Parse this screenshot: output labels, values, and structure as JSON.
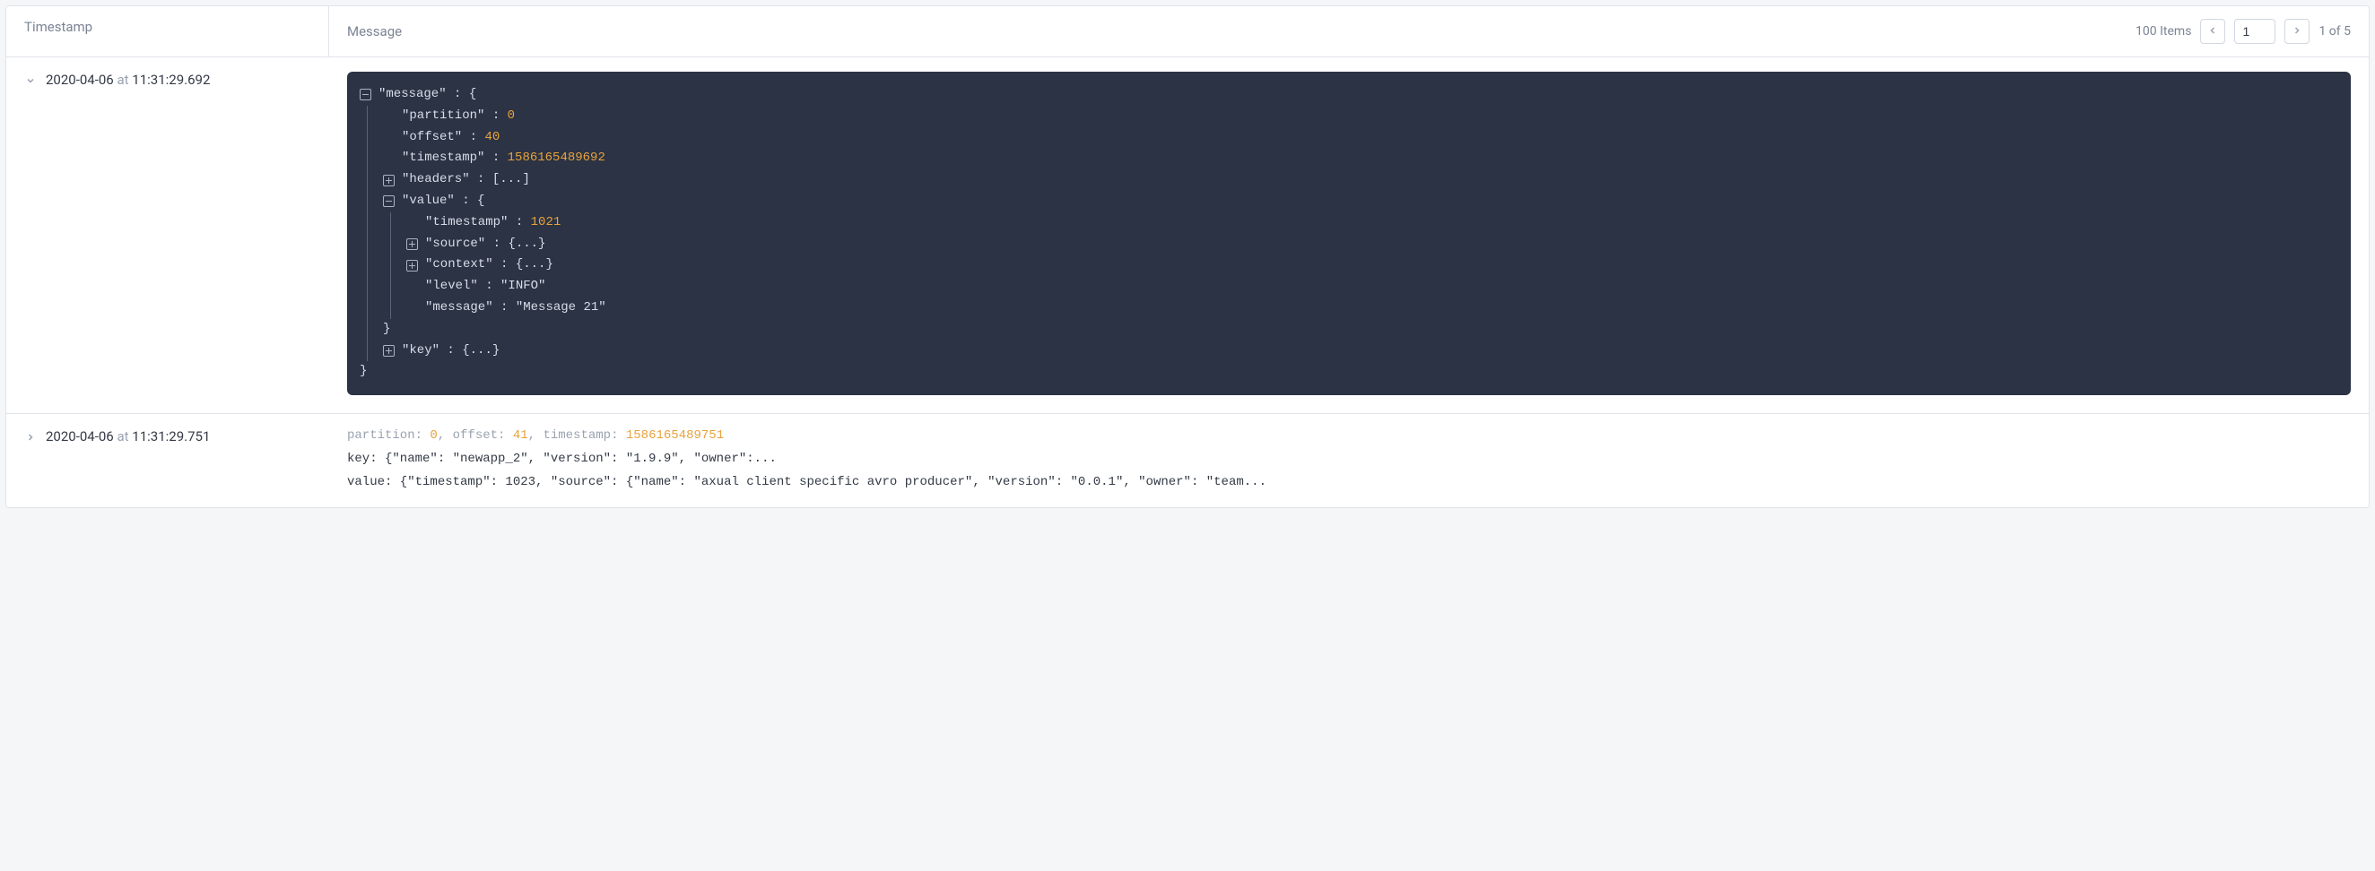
{
  "header": {
    "timestamp_label": "Timestamp",
    "message_label": "Message",
    "items_count": "100 Items",
    "page_input_value": "1",
    "page_of": "1 of 5"
  },
  "row1": {
    "date": "2020-04-06",
    "at": "at",
    "time": "11:31:29.692",
    "json": {
      "message_key": "\"message\"",
      "partition_key": "\"partition\"",
      "partition_val": "0",
      "offset_key": "\"offset\"",
      "offset_val": "40",
      "timestamp_key": "\"timestamp\"",
      "timestamp_val": "1586165489692",
      "headers_key": "\"headers\"",
      "headers_collapsed": "[...]",
      "value_key": "\"value\"",
      "v_timestamp_key": "\"timestamp\"",
      "v_timestamp_val": "1021",
      "v_source_key": "\"source\"",
      "brace_collapsed": "{...}",
      "v_context_key": "\"context\"",
      "v_level_key": "\"level\"",
      "v_level_val": "\"INFO\"",
      "v_message_key": "\"message\"",
      "v_message_val": "\"Message 21\"",
      "key_key": "\"key\""
    }
  },
  "row2": {
    "date": "2020-04-06",
    "at": "at",
    "time": "11:31:29.751",
    "meta_partition_label": "partition: ",
    "meta_partition_val": "0",
    "meta_offset_label": ", offset: ",
    "meta_offset_val": "41",
    "meta_timestamp_label": ", timestamp: ",
    "meta_timestamp_val": "1586165489751",
    "key_line": "key: {\"name\": \"newapp_2\", \"version\": \"1.9.9\", \"owner\":...",
    "value_line": "value: {\"timestamp\": 1023, \"source\": {\"name\": \"axual client specific avro producer\", \"version\": \"0.0.1\", \"owner\": \"team..."
  }
}
